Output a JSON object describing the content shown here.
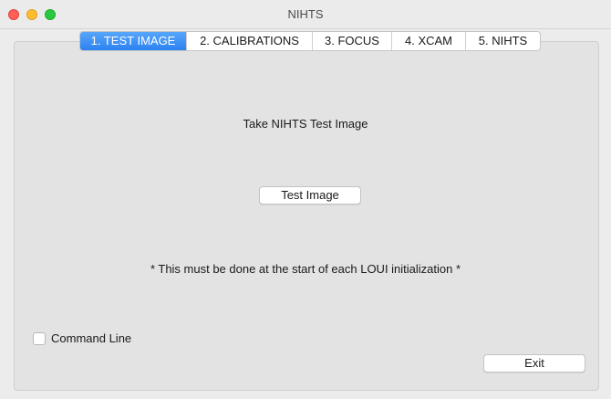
{
  "window": {
    "title": "NIHTS",
    "controls": [
      "close",
      "minimize",
      "maximize"
    ]
  },
  "tabs": [
    {
      "label": "1. TEST IMAGE",
      "active": true
    },
    {
      "label": "2. CALIBRATIONS",
      "active": false
    },
    {
      "label": "3. FOCUS",
      "active": false
    },
    {
      "label": "4. XCAM",
      "active": false
    },
    {
      "label": "5. NIHTS",
      "active": false
    }
  ],
  "main": {
    "heading": "Take NIHTS Test Image",
    "test_button_label": "Test Image",
    "note": "* This must be done at the start of each LOUI initialization *"
  },
  "footer": {
    "command_line_label": "Command Line",
    "command_line_checked": false,
    "exit_label": "Exit"
  },
  "colors": {
    "active_tab": "#2c82f0",
    "close": "#fe5f57",
    "minimize": "#febc2e",
    "maximize": "#28c840"
  }
}
